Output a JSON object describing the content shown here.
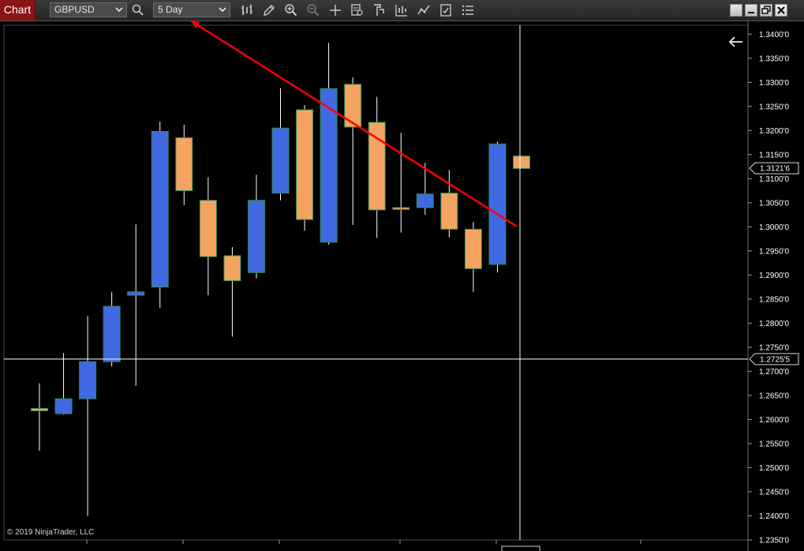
{
  "toolbar": {
    "chart_tab_label": "Chart",
    "instrument": "GBPUSD",
    "period": "5 Day",
    "icons": [
      "search-icon",
      "bar-type-icon",
      "draw-pencil-icon",
      "zoom-in-icon",
      "zoom-out-icon",
      "crosshair-icon",
      "data-box-icon",
      "indicators-icon",
      "strategies-icon",
      "chart-style-icon",
      "properties-icon",
      "object-list-icon"
    ],
    "window_controls": [
      "tile-button",
      "minimize-button",
      "restore-button",
      "close-button"
    ]
  },
  "colors": {
    "up_candle": "#4169e1",
    "down_candle": "#f4a460",
    "candle_outline": "#2e8b57",
    "wick": "#ffffff",
    "trendline": "#ff0000",
    "crosshair": "#ffffff",
    "background": "#000000",
    "toolbar_bg": "#2e2e2e",
    "chart_tab_bg": "#8b1414"
  },
  "chart": {
    "price_labels": [
      "1.3400'0",
      "1.3350'0",
      "1.3300'0",
      "1.3250'0",
      "1.3200'0",
      "1.3150'0",
      "1.3100'0",
      "1.3050'0",
      "1.3000'0",
      "1.2950'0",
      "1.2900'0",
      "1.2850'0",
      "1.2800'0",
      "1.2750'0",
      "1.2700'0",
      "1.2650'0",
      "1.2600'0",
      "1.2550'0",
      "1.2500'0",
      "1.2450'0",
      "1.2400'0",
      "1.2350'0"
    ],
    "last_price_label": "1.3121'6",
    "crosshair_price_label": "1.2725'5",
    "copyright": "© 2019 NinjaTrader, LLC",
    "back_arrow_icon": "back-arrow-icon"
  },
  "chart_data": {
    "type": "candlestick",
    "instrument": "GBPUSD",
    "period": "5 Day",
    "ylim": [
      1.2345,
      1.3425
    ],
    "bars": [
      {
        "o": 1.2623,
        "h": 1.2675,
        "l": 1.2535,
        "c": 1.2618
      },
      {
        "o": 1.2612,
        "h": 1.2738,
        "l": 1.261,
        "c": 1.2643
      },
      {
        "o": 1.2643,
        "h": 1.2815,
        "l": 1.24,
        "c": 1.272
      },
      {
        "o": 1.272,
        "h": 1.2865,
        "l": 1.271,
        "c": 1.2835
      },
      {
        "o": 1.2858,
        "h": 1.3005,
        "l": 1.267,
        "c": 1.2865
      },
      {
        "o": 1.2875,
        "h": 1.3218,
        "l": 1.2832,
        "c": 1.3198
      },
      {
        "o": 1.3185,
        "h": 1.3212,
        "l": 1.3045,
        "c": 1.3075
      },
      {
        "o": 1.3055,
        "h": 1.3103,
        "l": 1.2858,
        "c": 1.2938
      },
      {
        "o": 1.294,
        "h": 1.2958,
        "l": 1.2772,
        "c": 1.2888
      },
      {
        "o": 1.2905,
        "h": 1.3108,
        "l": 1.2893,
        "c": 1.3055
      },
      {
        "o": 1.307,
        "h": 1.3288,
        "l": 1.3055,
        "c": 1.3205
      },
      {
        "o": 1.3243,
        "h": 1.3253,
        "l": 1.2992,
        "c": 1.3015
      },
      {
        "o": 1.2968,
        "h": 1.3382,
        "l": 1.2963,
        "c": 1.3287
      },
      {
        "o": 1.3296,
        "h": 1.331,
        "l": 1.3004,
        "c": 1.3207
      },
      {
        "o": 1.3217,
        "h": 1.327,
        "l": 1.2977,
        "c": 1.3035
      },
      {
        "o": 1.304,
        "h": 1.3195,
        "l": 1.2988,
        "c": 1.3036
      },
      {
        "o": 1.304,
        "h": 1.3133,
        "l": 1.3025,
        "c": 1.3068
      },
      {
        "o": 1.307,
        "h": 1.3118,
        "l": 1.2978,
        "c": 1.2995
      },
      {
        "o": 1.2995,
        "h": 1.301,
        "l": 1.2865,
        "c": 1.2913
      },
      {
        "o": 1.2922,
        "h": 1.3177,
        "l": 1.2905,
        "c": 1.3172
      },
      {
        "o": 1.3147,
        "h": 1.3147,
        "l": 1.3121,
        "c": 1.3121
      }
    ],
    "last_price": 1.31216,
    "crosshair_price": 1.27255,
    "trendline": {
      "start_bar": 6.3,
      "start_price": 1.3427,
      "end_bar": 19.8,
      "end_price": 1.3001
    }
  }
}
